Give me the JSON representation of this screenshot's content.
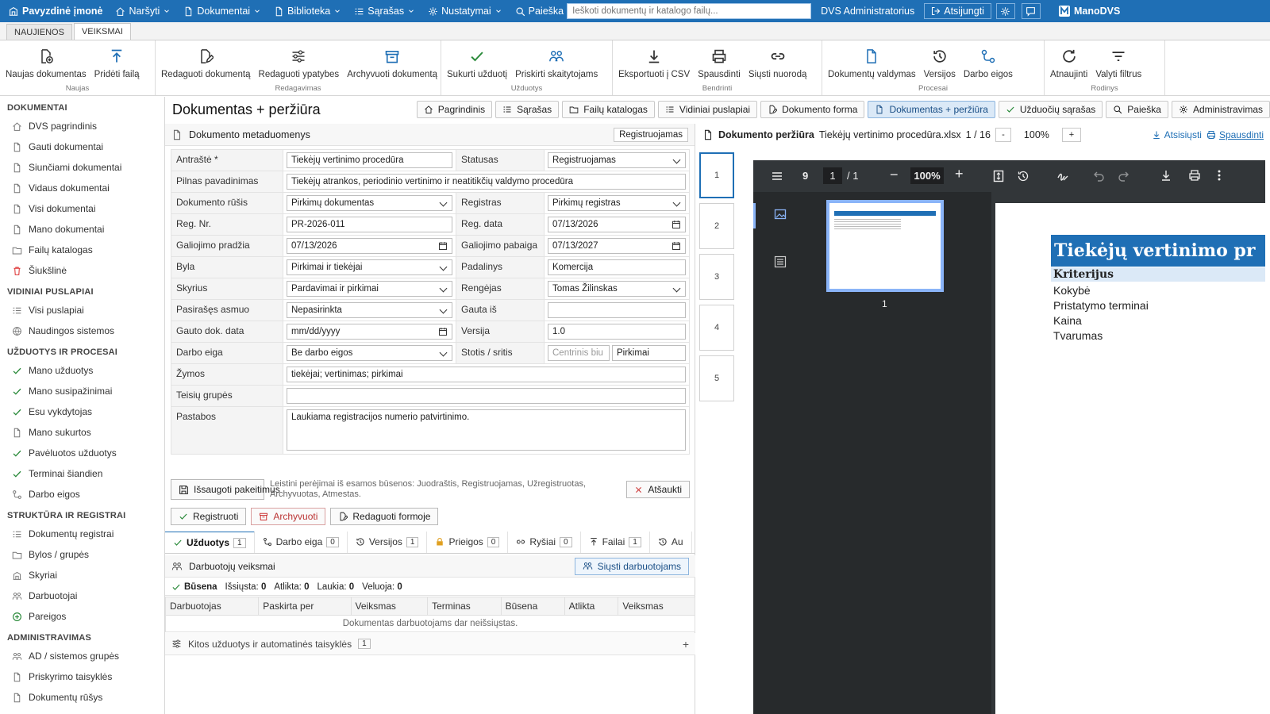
{
  "topbar": {
    "brand": "Pavyzdinė įmonė",
    "menus": [
      "Naršyti",
      "Dokumentai",
      "Biblioteka",
      "Sąrašas",
      "Nustatymai"
    ],
    "search_label": "Paieška",
    "search_placeholder": "Ieškoti dokumentų ir katalogo failų...",
    "user": "DVS Administratorius",
    "logout": "Atsijungti",
    "product": "ManoDVS"
  },
  "ribbon_tabs": [
    "NAUJIENOS",
    "VEIKSMAI"
  ],
  "ribbon": [
    {
      "label": "Naujas",
      "buttons": [
        {
          "label": "Naujas dokumentas",
          "icon": "new-doc-icon"
        },
        {
          "label": "Pridėti failą",
          "icon": "upload-icon"
        }
      ]
    },
    {
      "label": "Redagavimas",
      "buttons": [
        {
          "label": "Redaguoti dokumentą",
          "icon": "edit-doc-icon"
        },
        {
          "label": "Redaguoti ypatybes",
          "icon": "sliders-icon"
        },
        {
          "label": "Archyvuoti dokumentą",
          "icon": "archive-icon"
        }
      ]
    },
    {
      "label": "Užduotys",
      "buttons": [
        {
          "label": "Sukurti užduotį",
          "icon": "check-icon"
        },
        {
          "label": "Priskirti skaitytojams",
          "icon": "people-icon"
        }
      ]
    },
    {
      "label": "Bendrinti",
      "buttons": [
        {
          "label": "Eksportuoti į CSV",
          "icon": "download-icon"
        },
        {
          "label": "Spausdinti",
          "icon": "print-icon"
        },
        {
          "label": "Siųsti nuorodą",
          "icon": "link-icon"
        }
      ]
    },
    {
      "label": "Procesai",
      "buttons": [
        {
          "label": "Dokumentų valdymas",
          "icon": "document-icon"
        },
        {
          "label": "Versijos",
          "icon": "history-icon"
        },
        {
          "label": "Darbo eigos",
          "icon": "workflow-icon"
        }
      ]
    },
    {
      "label": "Rodinys",
      "buttons": [
        {
          "label": "Atnaujinti",
          "icon": "refresh-icon"
        },
        {
          "label": "Valyti filtrus",
          "icon": "filter-icon"
        }
      ]
    }
  ],
  "sidebar": [
    {
      "title": "DOKUMENTAI",
      "items": [
        {
          "label": "DVS pagrindinis",
          "icon": "home-icon"
        },
        {
          "label": "Gauti dokumentai",
          "icon": "file-icon"
        },
        {
          "label": "Siunčiami dokumentai",
          "icon": "file-icon"
        },
        {
          "label": "Vidaus dokumentai",
          "icon": "file-icon"
        },
        {
          "label": "Visi dokumentai",
          "icon": "file-icon"
        },
        {
          "label": "Mano dokumentai",
          "icon": "file-icon"
        },
        {
          "label": "Failų katalogas",
          "icon": "folder-icon"
        },
        {
          "label": "Šiukšlinė",
          "icon": "trash-icon"
        }
      ]
    },
    {
      "title": "VIDINIAI PUSLAPIAI",
      "items": [
        {
          "label": "Visi puslapiai",
          "icon": "list-icon"
        },
        {
          "label": "Naudingos sistemos",
          "icon": "globe-icon"
        }
      ]
    },
    {
      "title": "UŽDUOTYS IR PROCESAI",
      "items": [
        {
          "label": "Mano užduotys",
          "icon": "check-icon"
        },
        {
          "label": "Mano susipažinimai",
          "icon": "check-icon"
        },
        {
          "label": "Esu vykdytojas",
          "icon": "check-icon"
        },
        {
          "label": "Mano sukurtos",
          "icon": "file-icon"
        },
        {
          "label": "Pavėluotos užduotys",
          "icon": "check-icon"
        },
        {
          "label": "Terminai šiandien",
          "icon": "check-icon"
        },
        {
          "label": "Darbo eigos",
          "icon": "workflow-icon"
        }
      ]
    },
    {
      "title": "STRUKTŪRA IR REGISTRAI",
      "items": [
        {
          "label": "Dokumentų registrai",
          "icon": "list-icon"
        },
        {
          "label": "Bylos / grupės",
          "icon": "folder-icon"
        },
        {
          "label": "Skyriai",
          "icon": "building-icon"
        },
        {
          "label": "Darbuotojai",
          "icon": "people-icon"
        },
        {
          "label": "Pareigos",
          "icon": "badge-icon"
        }
      ]
    },
    {
      "title": "ADMINISTRAVIMAS",
      "items": [
        {
          "label": "AD / sistemos grupės",
          "icon": "people-icon"
        },
        {
          "label": "Priskyrimo taisyklės",
          "icon": "file-icon"
        },
        {
          "label": "Dokumentų rūšys",
          "icon": "file-icon"
        }
      ]
    }
  ],
  "page_title": "Dokumentas + peržiūra",
  "nav_tabs": [
    {
      "label": "Pagrindinis",
      "icon": "home-icon",
      "active": false
    },
    {
      "label": "Sąrašas",
      "icon": "list-icon",
      "active": false
    },
    {
      "label": "Failų katalogas",
      "icon": "folder-icon",
      "active": false
    },
    {
      "label": "Vidiniai puslapiai",
      "icon": "list-icon",
      "active": false
    },
    {
      "label": "Dokumento forma",
      "icon": "edit-doc-icon",
      "active": false
    },
    {
      "label": "Dokumentas + peržiūra",
      "icon": "file-icon",
      "active": true
    },
    {
      "label": "Užduočių sąrašas",
      "icon": "check-icon",
      "active": false
    },
    {
      "label": "Paieška",
      "icon": "search-icon",
      "active": false
    },
    {
      "label": "Administravimas",
      "icon": "gear-icon",
      "active": false
    }
  ],
  "meta": {
    "title": "Dokumento metaduomenys",
    "badge": "Registruojamas",
    "antraste_label": "Antraštė *",
    "antraste": "Tiekėjų vertinimo procedūra",
    "statusas_label": "Statusas",
    "statusas": "Registruojamas",
    "pilnas_label": "Pilnas pavadinimas",
    "pilnas": "Tiekėjų atrankos, periodinio vertinimo ir neatitikčių valdymo procedūra",
    "rusis_label": "Dokumento rūšis",
    "rusis": "Pirkimų dokumentas",
    "registras_label": "Registras",
    "registras": "Pirkimų registras",
    "regnr_label": "Reg. Nr.",
    "regnr": "PR-2026-011",
    "regdata_label": "Reg. data",
    "regdata": "07/13/2026",
    "galpr_label": "Galiojimo pradžia",
    "galpr": "07/13/2026",
    "galpab_label": "Galiojimo pabaiga",
    "galpab": "07/13/2027",
    "byla_label": "Byla",
    "byla": "Pirkimai ir tiekėjai",
    "padalinys_label": "Padalinys",
    "padalinys": "Komercija",
    "skyrius_label": "Skyrius",
    "skyrius": "Pardavimai ir pirkimai",
    "rengejas_label": "Rengėjas",
    "rengejas": "Tomas Žilinskas",
    "pasirases_label": "Pasirašęs asmuo",
    "pasirases": "Nepasirinkta",
    "gautais_label": "Gauta iš",
    "gautais": "",
    "gautodata_label": "Gauto dok. data",
    "gautodata_placeholder": "mm/dd/yyyy",
    "versija_label": "Versija",
    "versija": "1.0",
    "darboeiga_label": "Darbo eiga",
    "darboeiga": "Be darbo eigos",
    "stotis_label": "Stotis / sritis",
    "stotis_placeholder": "Centrinis biu",
    "sritis": "Pirkimai",
    "zymos_label": "Žymos",
    "zymos": "tiekėjai; vertinimas; pirkimai",
    "teisiu_label": "Teisių grupės",
    "teisiu": "",
    "pastabos_label": "Pastabos",
    "pastabos": "Laukiama registracijos numerio patvirtinimo."
  },
  "actions": {
    "save": "Išsaugoti pakeitimus",
    "hint": "Leistini perėjimai iš esamos būsenos: Juodraštis, Registruojamas, Užregistruotas, Archyvuotas, Atmestas.",
    "cancel": "Atšaukti",
    "register": "Registruoti",
    "archive": "Archyvuoti",
    "edit_form": "Redaguoti formoje"
  },
  "subtabs": [
    {
      "label": "Užduotys",
      "count": "1",
      "icon": "check-icon",
      "active": true
    },
    {
      "label": "Darbo eiga",
      "count": "0",
      "icon": "workflow-icon"
    },
    {
      "label": "Versijos",
      "count": "1",
      "icon": "history-icon"
    },
    {
      "label": "Prieigos",
      "count": "0",
      "icon": "lock-icon"
    },
    {
      "label": "Ryšiai",
      "count": "0",
      "icon": "link-icon"
    },
    {
      "label": "Failai",
      "count": "1",
      "icon": "upload-icon"
    },
    {
      "label": "Au",
      "count": "",
      "icon": "history-icon"
    }
  ],
  "tasks": {
    "title": "Darbuotojų veiksmai",
    "send": "Siųsti darbuotojams",
    "status_label": "Būsena",
    "stats": [
      {
        "label": "Išsiųsta:",
        "value": "0"
      },
      {
        "label": "Atlikta:",
        "value": "0"
      },
      {
        "label": "Laukia:",
        "value": "0"
      },
      {
        "label": "Veluoja:",
        "value": "0"
      }
    ],
    "columns": [
      "Darbuotojas",
      "Paskirta per",
      "Veiksmas",
      "Terminas",
      "Būsena",
      "Atlikta",
      "Veiksmas"
    ],
    "empty": "Dokumentas darbuotojams dar neišsiųstas.",
    "other_label": "Kitos užduotys ir automatinės taisyklės",
    "other_count": "1",
    "other_toggle": "+"
  },
  "preview": {
    "title": "Dokumento peržiūra",
    "file": "Tiekėjų vertinimo procedūra.xlsx",
    "pages": "1 / 16",
    "zoom": "100%",
    "minus": "-",
    "plus": "+",
    "download": "Atsisiųsti",
    "print": "Spausdinti",
    "thumbs": [
      "1",
      "2",
      "3",
      "4",
      "5"
    ],
    "viewer": {
      "count": "9",
      "page": "1",
      "total": "/ 1",
      "zoom": "100%",
      "thumb_label": "1",
      "doc_title": "Tiekėjų vertinimo pr",
      "doc_header": "Kriterijus",
      "doc_lines": [
        "Kokybė",
        "Pristatymo terminai",
        "Kaina",
        "Tvarumas"
      ]
    }
  }
}
